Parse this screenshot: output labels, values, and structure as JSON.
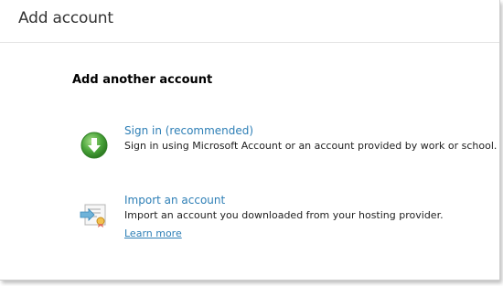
{
  "window": {
    "title": "Add account"
  },
  "main": {
    "section_title": "Add another account",
    "options": [
      {
        "title": "Sign in (recommended)",
        "description": "Sign in using Microsoft Account or an account provided by work or school.",
        "icon": "download-arrow-icon",
        "icon_color": "#4aa43a"
      },
      {
        "title": "Import an account",
        "description": "Import an account you downloaded from your hosting provider.",
        "link": "Learn more",
        "icon": "import-certificate-icon"
      }
    ]
  },
  "colors": {
    "link": "#2e7fb6",
    "text": "#222222",
    "title": "#333333"
  }
}
